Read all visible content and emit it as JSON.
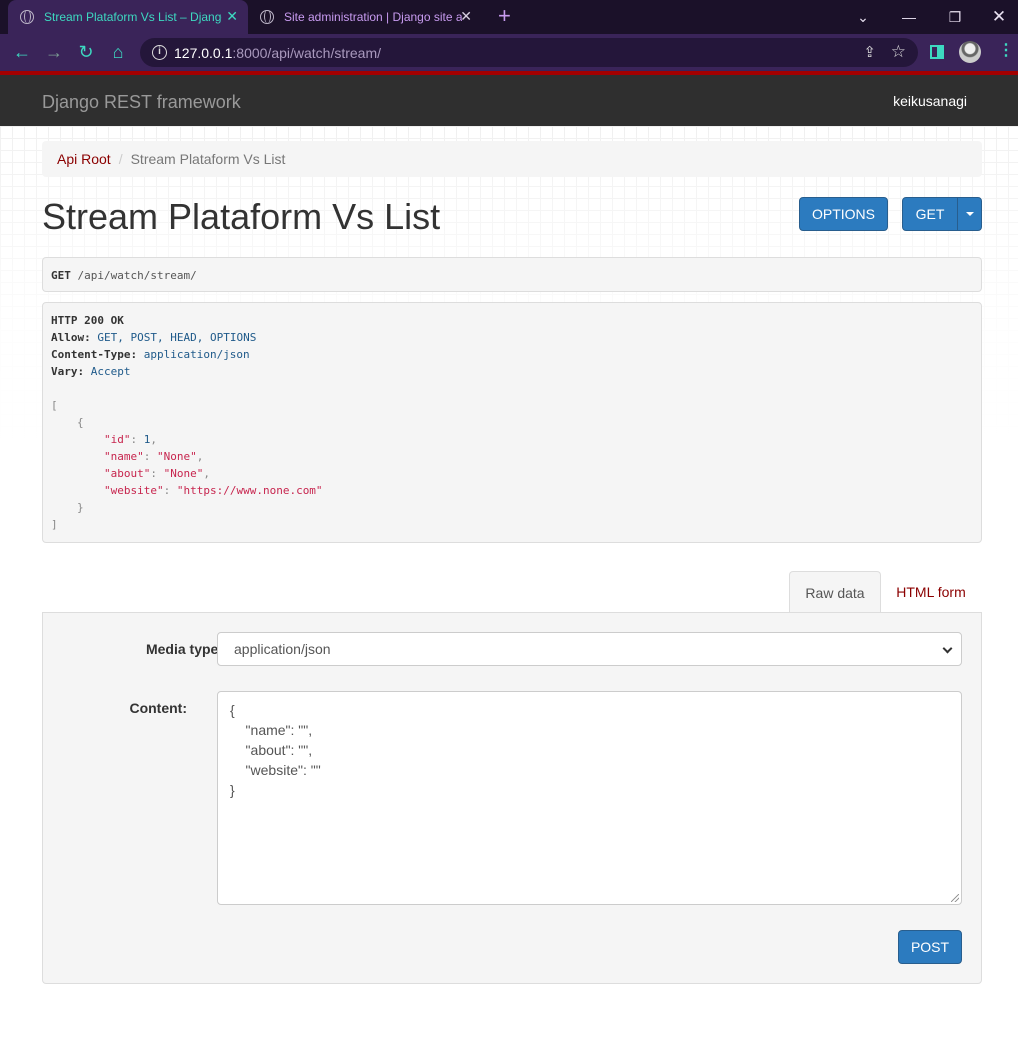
{
  "browser": {
    "tabs": [
      {
        "title": "Stream Plataform Vs List – Django REST framework",
        "active": true
      },
      {
        "title": "Site administration | Django site admin",
        "active": false
      }
    ],
    "new_tab_icon": "+",
    "url_host": "127.0.0.1",
    "url_rest": ":8000/api/watch/stream/",
    "accent_color": "#3dd9c1",
    "tab_bg_color": "#3a2459"
  },
  "navbar": {
    "brand": "Django REST framework",
    "user": "keikusanagi"
  },
  "breadcrumb": {
    "root": "Api Root",
    "separator": "/",
    "current": "Stream Plataform Vs List"
  },
  "page": {
    "title": "Stream Plataform Vs List",
    "options_button": "OPTIONS",
    "get_button": "GET"
  },
  "request": {
    "method": "GET",
    "path": "/api/watch/stream/"
  },
  "response": {
    "status": "HTTP 200 OK",
    "headers": [
      {
        "key": "Allow:",
        "value": "GET, POST, HEAD, OPTIONS"
      },
      {
        "key": "Content-Type:",
        "value": "application/json"
      },
      {
        "key": "Vary:",
        "value": "Accept"
      }
    ],
    "body": {
      "open_array": "[",
      "open_obj": "{",
      "fields": [
        {
          "key": "\"id\"",
          "value": "1",
          "type": "number"
        },
        {
          "key": "\"name\"",
          "value": "\"None\"",
          "type": "string"
        },
        {
          "key": "\"about\"",
          "value": "\"None\"",
          "type": "string"
        },
        {
          "key": "\"website\"",
          "value": "\"https://www.none.com\"",
          "type": "string"
        }
      ],
      "close_obj": "}",
      "close_array": "]"
    }
  },
  "form": {
    "tabs": [
      "Raw data",
      "HTML form"
    ],
    "media_type_label": "Media type:",
    "media_type_value": "application/json",
    "content_label": "Content:",
    "content_lines": [
      "{",
      "    \"name\": \"\",",
      "    \"about\": \"\",",
      "    \"website\": \"\"",
      "}"
    ],
    "post_button": "POST"
  }
}
